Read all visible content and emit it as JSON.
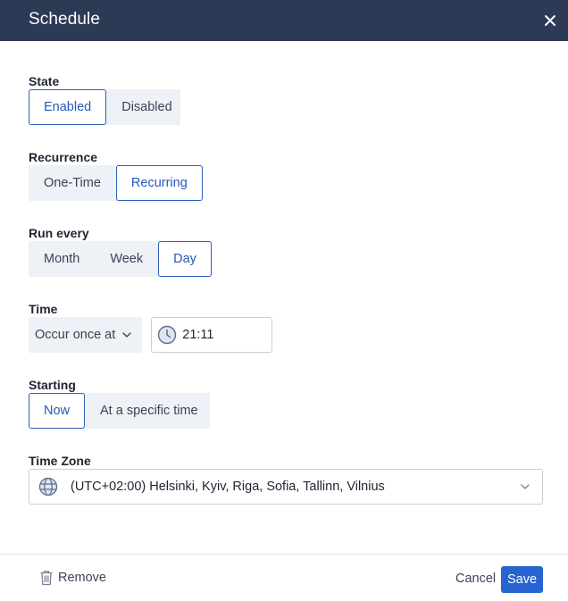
{
  "dialog": {
    "title": "Schedule",
    "close_icon": "close-icon"
  },
  "state": {
    "label": "State",
    "options": [
      "Enabled",
      "Disabled"
    ],
    "selected": "Enabled"
  },
  "recurrence": {
    "label": "Recurrence",
    "options": [
      "One-Time",
      "Recurring"
    ],
    "selected": "Recurring"
  },
  "run_every": {
    "label": "Run every",
    "options": [
      "Month",
      "Week",
      "Day"
    ],
    "selected": "Day"
  },
  "time": {
    "label": "Time",
    "mode": "Occur once at",
    "value": "21:11",
    "icon": "clock-icon"
  },
  "starting": {
    "label": "Starting",
    "options": [
      "Now",
      "At a specific time"
    ],
    "selected": "Now"
  },
  "time_zone": {
    "label": "Time Zone",
    "value": "(UTC+02:00) Helsinki, Kyiv, Riga, Sofia, Tallinn, Vilnius",
    "icon": "globe-icon"
  },
  "footer": {
    "remove_label": "Remove",
    "cancel_label": "Cancel",
    "save_label": "Save"
  },
  "colors": {
    "header_bg": "#2d3a55",
    "accent": "#2764d1",
    "segment_bg": "#eef1f5"
  }
}
